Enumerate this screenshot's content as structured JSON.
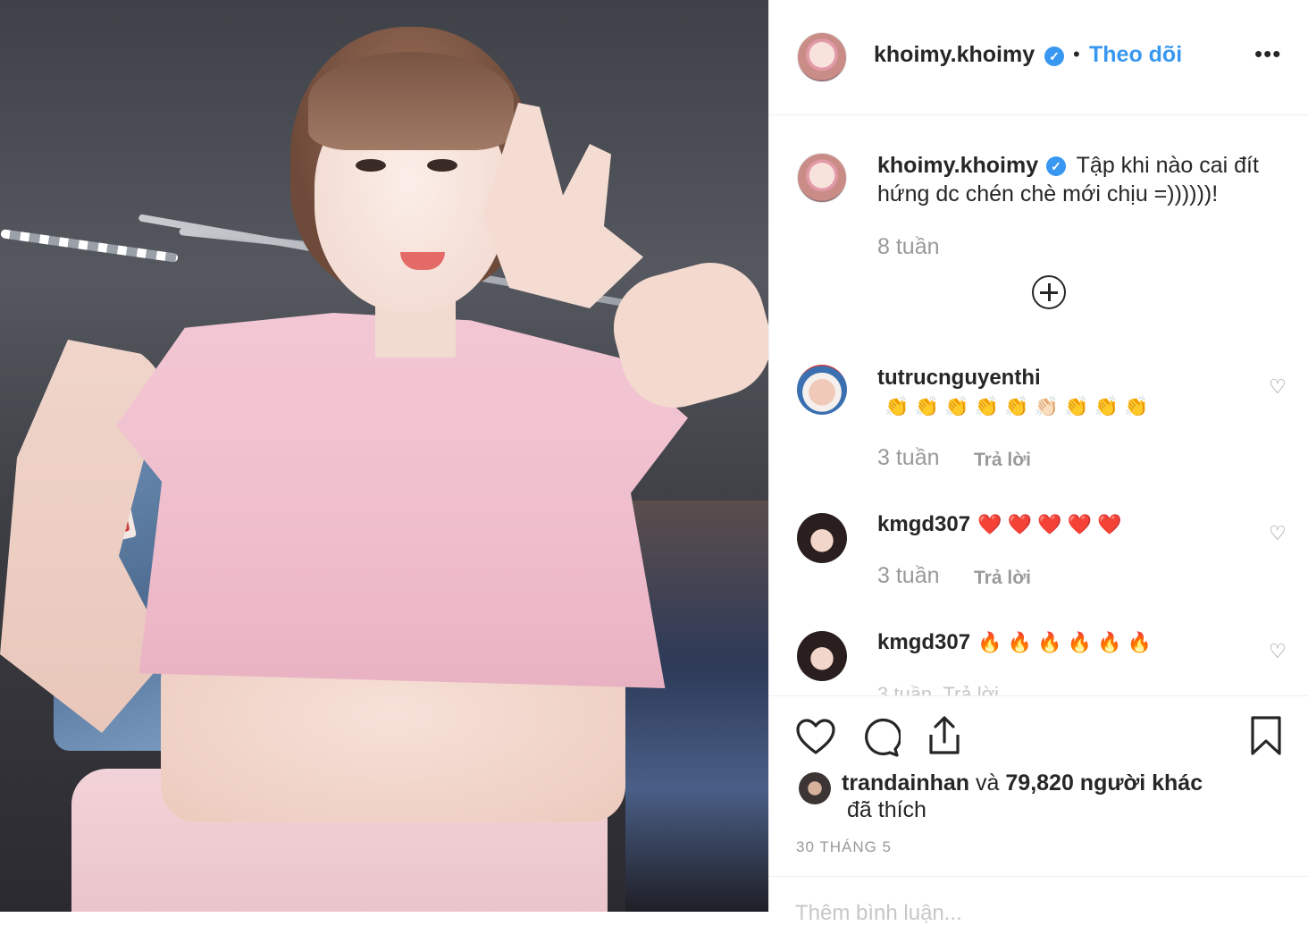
{
  "post": {
    "username": "khoimy.khoimy",
    "verified_glyph": "✓",
    "follow_dot": "•",
    "follow_label": "Theo dõi",
    "more_glyph": "•••"
  },
  "caption": {
    "username": "khoimy.khoimy",
    "text": "Tập khi nào cai đít hứng dc chén chè mới chịu =))))))!",
    "time": "8 tuần"
  },
  "comments": [
    {
      "username": "tutrucnguyenthi",
      "emoji": "👏 👏 👏 👏 👏 👏🏻 👏 👏 👏",
      "time": "3 tuần",
      "reply": "Trả lời"
    },
    {
      "username": "kmgd307",
      "emoji": "❤️ ❤️ ❤️ ❤️ ❤️",
      "time": "3 tuần",
      "reply": "Trả lời"
    },
    {
      "username": "kmgd307",
      "emoji": "🔥 🔥 🔥 🔥 🔥 🔥",
      "time": "3 tuần",
      "reply": "Trả lời"
    }
  ],
  "likes": {
    "user": "trandainhan",
    "and": "và",
    "count_text": "79,820 người khác",
    "liked": "đã thích"
  },
  "date": "30 THÁNG 5",
  "add_comment_placeholder": "Thêm bình luận...",
  "icons": [
    "heart-icon",
    "comment-icon",
    "share-icon",
    "bookmark-icon",
    "add-icon",
    "verified-badge-icon",
    "more-options-icon"
  ],
  "colors": {
    "accent": "#3897f0",
    "muted": "#999999",
    "text": "#262626"
  }
}
